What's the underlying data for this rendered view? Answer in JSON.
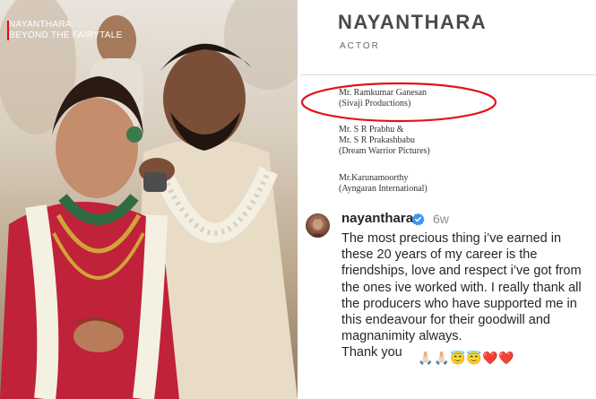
{
  "photo": {
    "series_title_line1": "NAYANTHARA:",
    "series_title_line2": "BEYOND THE FAIRYTALE",
    "description_icon": "wedding-photo"
  },
  "document": {
    "name": "NAYANTHARA",
    "role": "ACTOR",
    "producers": [
      {
        "line1": "Mr. Ramkumar Ganesan",
        "line2": "(Sivaji Productions)"
      },
      {
        "line1": "Mr. S R Prabhu &",
        "line2": "Mr. S R Prakashbabu",
        "line3": "(Dream Warrior Pictures)"
      },
      {
        "line1": "Mr.Karunamoorthy",
        "line2": "(Ayngaran International)"
      }
    ],
    "highlight_color": "#e0141c"
  },
  "post": {
    "username": "nayanthara",
    "verified_icon": "verified-badge-icon",
    "age": "6w",
    "caption": "The most precious thing i’ve earned in these 20 years of my career is the friendships, love and respect i’ve got from the ones ive worked with. I really thank all the producers who have supported me in this endeavour for their goodwill and magnanimity always.",
    "closing": "Thank you",
    "emojis": [
      "🙏🏻",
      "🙏🏻",
      "😇",
      "😇",
      "❤️",
      "❤️"
    ],
    "verified_color": "#3897f0"
  }
}
